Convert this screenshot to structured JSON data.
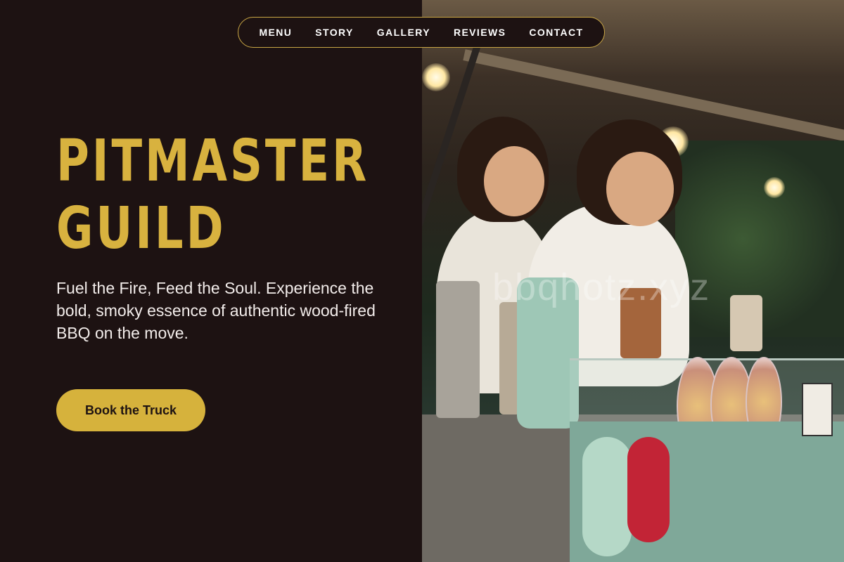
{
  "nav": {
    "items": [
      "MENU",
      "STORY",
      "GALLERY",
      "REVIEWS",
      "CONTACT"
    ]
  },
  "hero": {
    "title_line1": "PITMASTER",
    "title_line2": "GUILD",
    "tagline": "Fuel the Fire, Feed the Soul. Experience the bold, smoky essence of authentic wood-fired BBQ on the move.",
    "cta_label": "Book the Truck"
  },
  "photo": {
    "watermark": "bbqhotz.xyz"
  },
  "colors": {
    "background": "#1d1212",
    "accent": "#d6b23c",
    "text": "#f2ecea"
  }
}
